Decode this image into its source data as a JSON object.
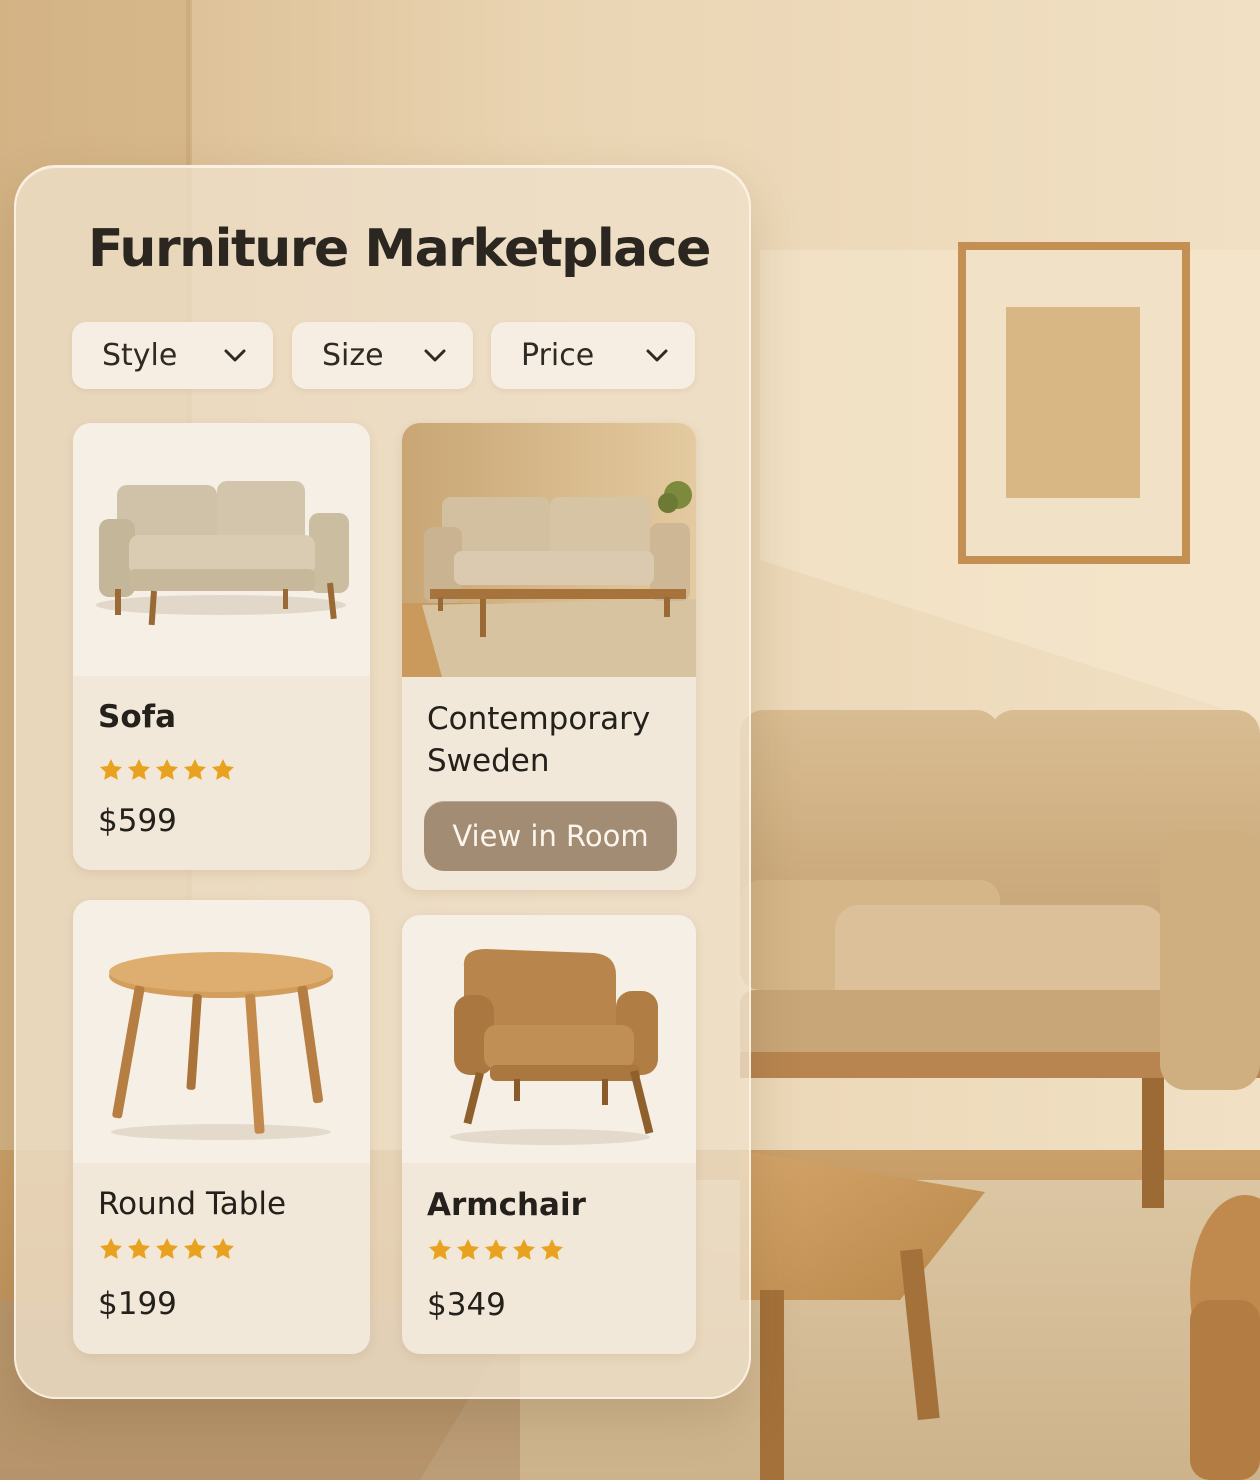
{
  "app": {
    "title": "Furniture Marketplace"
  },
  "filters": [
    {
      "label": "Style",
      "icon": "chevron-down-icon"
    },
    {
      "label": "Size",
      "icon": "chevron-down-icon"
    },
    {
      "label": "Price",
      "icon": "chevron-down-icon"
    }
  ],
  "products": [
    {
      "name": "Sofa",
      "rating": 5,
      "rating_max": 5,
      "price": "$599"
    },
    {
      "name": "Contemporary Sweden",
      "name_lines": [
        "Contemporary",
        "Sweden"
      ],
      "action_label": "View in Room"
    },
    {
      "name": "Round Table",
      "rating": 5,
      "rating_max": 5,
      "price": "$199"
    },
    {
      "name": "Armchair",
      "rating": 5,
      "rating_max": 5,
      "price": "$349"
    }
  ],
  "colors": {
    "star": "#e9a21f",
    "button": "#a38c74",
    "card": "#f2e8d9",
    "text": "#24201b"
  }
}
